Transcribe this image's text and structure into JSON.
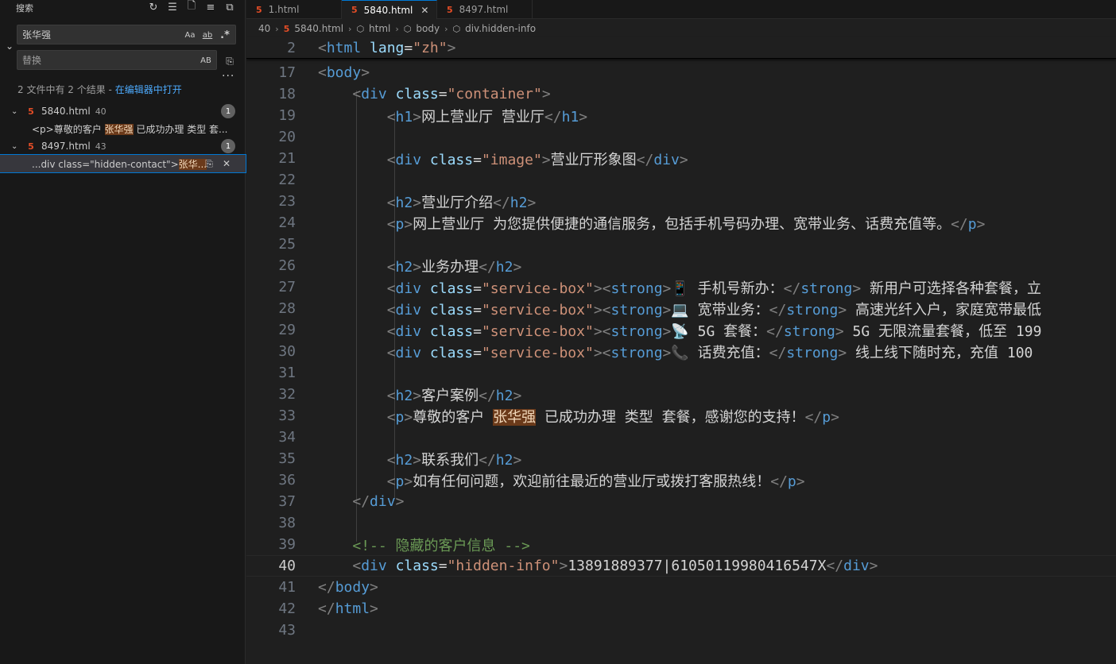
{
  "sidebar": {
    "title": "搜索",
    "search_value": "张华强",
    "replace_placeholder": "替换",
    "opt_case": "Aa",
    "opt_word": "ab",
    "opt_regex": ".*",
    "opt_preserve": "AB",
    "summary_text": "2 文件中有 2 个结果 - ",
    "summary_link": "在编辑器中打开",
    "results": [
      {
        "file": "5840.html",
        "count_label": "40",
        "badge": "1",
        "match_pre": "<p>尊敬的客户 ",
        "match_hl": "张华强",
        "match_post": " 已成功办理 类型 套..."
      },
      {
        "file": "8497.html",
        "count_label": "43",
        "badge": "1",
        "match_pre": "...div class=\"hidden-contact\">",
        "match_hl": "张华...",
        "match_post": ""
      }
    ]
  },
  "tabs": [
    {
      "label": "1.html"
    },
    {
      "label": "5840.html"
    },
    {
      "label": "8497.html"
    }
  ],
  "breadcrumb": {
    "folder": "40",
    "file": "5840.html",
    "node1": "html",
    "node2": "body",
    "node3": "div.hidden-info"
  },
  "editor": {
    "lines": [
      {
        "n": "2"
      },
      {
        "n": "17"
      },
      {
        "n": "18"
      },
      {
        "n": "19"
      },
      {
        "n": "20"
      },
      {
        "n": "21"
      },
      {
        "n": "22"
      },
      {
        "n": "23"
      },
      {
        "n": "24"
      },
      {
        "n": "25"
      },
      {
        "n": "26"
      },
      {
        "n": "27"
      },
      {
        "n": "28"
      },
      {
        "n": "29"
      },
      {
        "n": "30"
      },
      {
        "n": "31"
      },
      {
        "n": "32"
      },
      {
        "n": "33"
      },
      {
        "n": "34"
      },
      {
        "n": "35"
      },
      {
        "n": "36"
      },
      {
        "n": "37"
      },
      {
        "n": "38"
      },
      {
        "n": "39"
      },
      {
        "n": "40"
      },
      {
        "n": "41"
      },
      {
        "n": "42"
      },
      {
        "n": "43"
      }
    ],
    "text": {
      "lang_val": "\"zh\"",
      "container_val": "\"container\"",
      "h1_text": "网上营业厅 营业厅",
      "image_val": "\"image\"",
      "image_text": "营业厅形象图",
      "h2_intro": "营业厅介绍",
      "p_intro": "网上营业厅 为您提供便捷的通信服务，包括手机号码办理、宽带业务、话费充值等。",
      "h2_service": "业务办理",
      "sb_val": "\"service-box\"",
      "s1_strong": "📱 手机号新办：",
      "s1_rest": " 新用户可选择各种套餐，立",
      "s2_strong": "💻 宽带业务：",
      "s2_rest": " 高速光纤入户，家庭宽带最低",
      "s3_strong": "📡 5G 套餐：",
      "s3_rest": " 5G 无限流量套餐，低至 199",
      "s4_strong": "📞 话费充值：",
      "s4_rest": " 线上线下随时充，充值 100",
      "h2_case": "客户案例",
      "p_case_pre": "尊敬的客户 ",
      "p_case_hl": "张华强",
      "p_case_post": " 已成功办理 类型 套餐，感谢您的支持！",
      "h2_contact": "联系我们",
      "p_contact": "如有任何问题，欢迎前往最近的营业厅或拨打客服热线！",
      "comment": "<!-- 隐藏的客户信息 -->",
      "hidden_val": "\"hidden-info\"",
      "hidden_text": "13891889377|61050119980416547X"
    }
  }
}
